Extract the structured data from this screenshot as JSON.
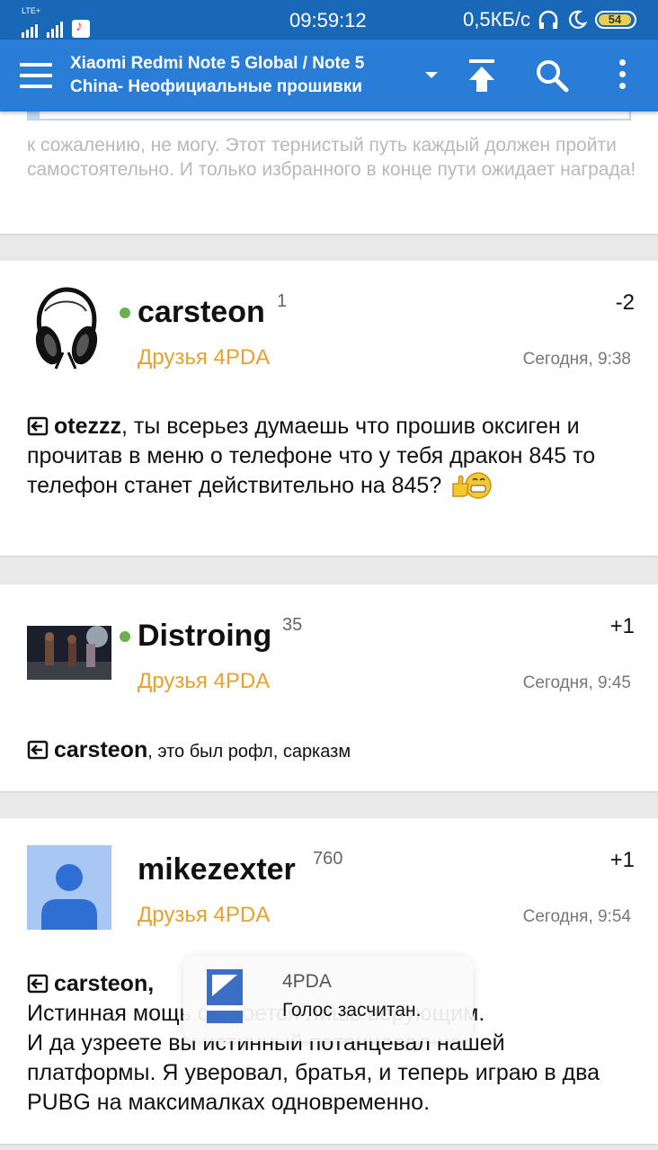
{
  "status_bar": {
    "network": "LTE+",
    "time": "09:59:12",
    "speed": "0,5КБ/с",
    "battery": "54"
  },
  "app_bar": {
    "title": "Xiaomi Redmi Note 5 Global / Note 5 China- Неофициальные прошивки"
  },
  "previous_post": {
    "text": "к сожалению, не могу. Этот тернистый путь каждый должен пройти самостоятельно. И только избранного в конце пути ожидает награда!"
  },
  "posts": [
    {
      "username": "carsteon",
      "reputation": "1",
      "group": "Друзья 4PDA",
      "score": "-2",
      "date": "Сегодня, 9:38",
      "reply_to": "otezzz",
      "text": ", ты всерьез думаешь что прошив оксиген и прочитав в меню о телефоне что у тебя дракон 845 то телефон станет действительно на 845?"
    },
    {
      "username": "Distroing",
      "reputation": "35",
      "group": "Друзья 4PDA",
      "score": "+1",
      "date": "Сегодня, 9:45",
      "reply_to": "carsteon",
      "text": ", это был рофл, сарказм"
    },
    {
      "username": "mikezexter",
      "reputation": "760",
      "group": "Друзья 4PDA",
      "score": "+1",
      "date": "Сегодня, 9:54",
      "reply_to": "carsteon,",
      "line1": "Истинная мощь откроется лишь верующим.",
      "text": "И да узреете вы истинный потанцевал нашей платформы. Я уверовал, братья, и теперь играю в два PUBG на максималках одновременно."
    }
  ],
  "toast": {
    "app": "4PDA",
    "message": "Голос засчитан."
  },
  "colors": {
    "status_bar": "#1968b8",
    "app_bar": "#2a7dd6",
    "group": "#e8a12c",
    "online": "#6ab04c"
  }
}
